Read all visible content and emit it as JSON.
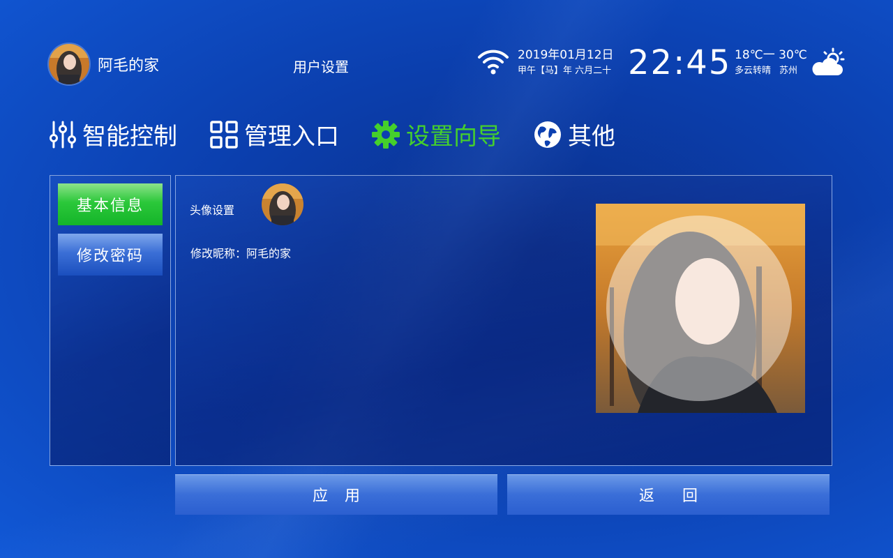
{
  "header": {
    "user_name": "阿毛的家",
    "page_title": "用户设置",
    "date": "2019年01月12日",
    "lunar_date": "甲午【马】年 六月二十",
    "time": "22:45",
    "temperature": "18℃一 30℃",
    "weather": "多云转晴",
    "city": "苏州",
    "icons": [
      "wifi-icon",
      "partly-cloudy-icon"
    ]
  },
  "nav": {
    "items": [
      {
        "label": "智能控制",
        "icon": "sliders-icon"
      },
      {
        "label": "管理入口",
        "icon": "grid-icon"
      },
      {
        "label": "设置向导",
        "icon": "gear-icon",
        "active": true
      },
      {
        "label": "其他",
        "icon": "globe-icon"
      }
    ],
    "active_color": "#45d02c"
  },
  "sidebar": {
    "items": [
      {
        "label": "基本信息",
        "active": true
      },
      {
        "label": "修改密码",
        "active": false
      }
    ]
  },
  "form": {
    "avatar_label": "头像设置",
    "nickname_label": "修改昵称：",
    "nickname_value": "阿毛的家"
  },
  "actions": {
    "apply_label": "应用",
    "back_label": "返回"
  }
}
